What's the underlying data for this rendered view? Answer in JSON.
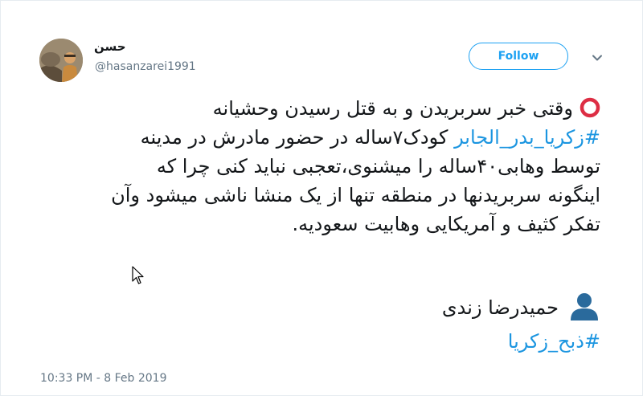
{
  "author": {
    "display_name": "حسن",
    "handle": "@hasanzarei1991"
  },
  "actions": {
    "follow_label": "Follow",
    "menu_icon": "chevron-down-icon"
  },
  "tweet": {
    "lead_icon": "red-circle-icon",
    "lines": [
      {
        "text": "وقتی خبر سربریدن و به قتل رسیدن وحشیانه"
      },
      {
        "hashtag": "#زکریا_بدر_الجابر",
        "text": " کودک۷ساله در حضور مادرش در مدینه"
      },
      {
        "text": "توسط وهابی۴۰ساله را میشنوی،تعجبی نباید کنی چرا که"
      },
      {
        "text": "اینگونه سربریدنها در منطقه تنها از یک منشا ناشی میشود وآن"
      },
      {
        "text": "تفکر کثیف و آمریکایی وهابیت سعودیه."
      }
    ],
    "signature_icon": "person-icon",
    "signature": "حمیدرضا زندی",
    "closing_hashtag": "#ذبح_زکریا",
    "timestamp": "10:33 PM - 8 Feb 2019"
  },
  "colors": {
    "link": "#1b95e0",
    "follow_border": "#1da1f2",
    "meta_gray": "#657786",
    "red_circle": "#dd2e44",
    "person_blue": "#2a6a9c"
  }
}
